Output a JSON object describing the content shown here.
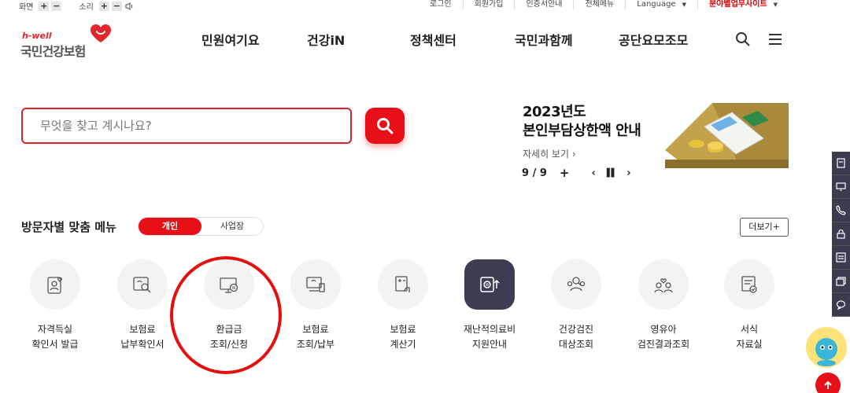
{
  "util": {
    "screen_label": "화면",
    "sound_label": "소리",
    "plus": "+",
    "minus": "−",
    "links": [
      "로그인",
      "회원가입",
      "인증서안내",
      "전체메뉴",
      "Language",
      "분야별업무사이트"
    ]
  },
  "logo": {
    "tagline": "h-well",
    "name": "국민건강보험"
  },
  "gnb": [
    "민원여기요",
    "건강iN",
    "정책센터",
    "국민과함께",
    "공단요모조모"
  ],
  "search": {
    "placeholder": "무엇을 찾고 계시나요?"
  },
  "banner": {
    "title_line1": "2023년도",
    "title_line2": "본인부담상한액 안내",
    "more": "자세히 보기 ›",
    "counter": "9 / 9",
    "plus": "+"
  },
  "custom_menu": {
    "title": "방문자별 맞춤 메뉴",
    "tabs": [
      "개인",
      "사업장"
    ],
    "more": "더보기+",
    "items": [
      {
        "label": "자격득실\n확인서 발급",
        "icon": "id-card-icon"
      },
      {
        "label": "보험료\n납부확인서",
        "icon": "document-search-icon"
      },
      {
        "label": "환급금\n조회/신청",
        "icon": "monitor-refund-icon"
      },
      {
        "label": "보험료\n조회/납부",
        "icon": "computer-payment-icon"
      },
      {
        "label": "보험료\n계산기",
        "icon": "calculator-hand-icon"
      },
      {
        "label": "재난적의료비\n지원안내",
        "icon": "support-card-icon"
      },
      {
        "label": "건강검진\n대상조회",
        "icon": "people-search-icon"
      },
      {
        "label": "영유아\n검진결과조회",
        "icon": "family-icon"
      },
      {
        "label": "서식\n자료실",
        "icon": "form-document-icon"
      }
    ]
  },
  "colors": {
    "brand_red": "#e80f18",
    "dark_navy": "#3b3d52"
  }
}
